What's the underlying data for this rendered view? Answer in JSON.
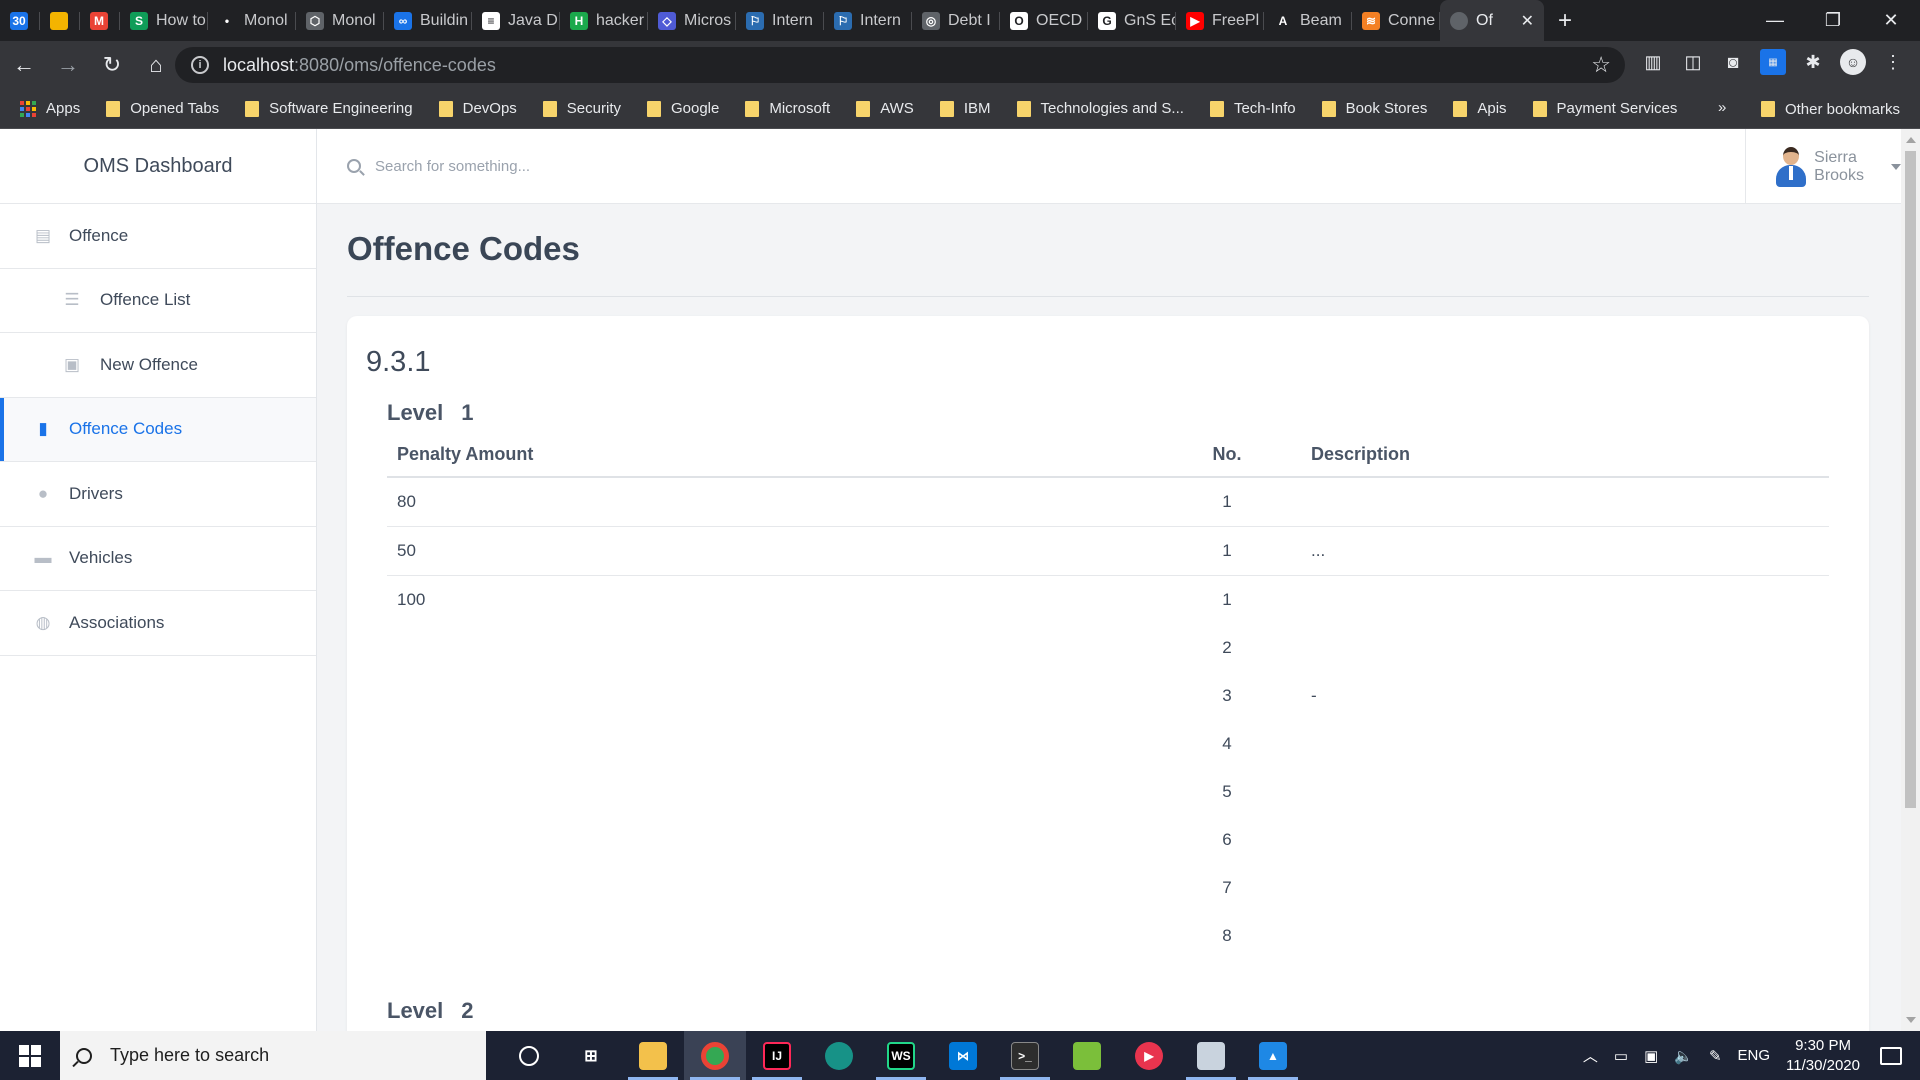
{
  "browser": {
    "tabs": [
      {
        "label": "",
        "color": "#1a73e8",
        "glyph": "30"
      },
      {
        "label": "",
        "color": "#f4b400",
        "glyph": ""
      },
      {
        "label": "",
        "color": "#ea4335",
        "glyph": "M"
      },
      {
        "label": "How to",
        "color": "#0f9d58",
        "glyph": "S"
      },
      {
        "label": "Monol",
        "color": "#202124",
        "glyph": "•"
      },
      {
        "label": "Monol",
        "color": "#5f6368",
        "glyph": "⬡"
      },
      {
        "label": "Buildin",
        "color": "#1a73e8",
        "glyph": "∞"
      },
      {
        "label": "Java D",
        "color": "#ffffff",
        "glyph": "≡"
      },
      {
        "label": "hacker",
        "color": "#1ba94c",
        "glyph": "H"
      },
      {
        "label": "Micros",
        "color": "#4f5bd5",
        "glyph": "◇"
      },
      {
        "label": "Intern",
        "color": "#2b6cb0",
        "glyph": "⚐"
      },
      {
        "label": "Intern",
        "color": "#2b6cb0",
        "glyph": "⚐"
      },
      {
        "label": "Debt I",
        "color": "#5f6368",
        "glyph": "◎"
      },
      {
        "label": "OECD",
        "color": "#ffffff",
        "glyph": "O"
      },
      {
        "label": "GnS Ec",
        "color": "#ffffff",
        "glyph": "G"
      },
      {
        "label": "FreePl",
        "color": "#ff0000",
        "glyph": "▶"
      },
      {
        "label": "Beam",
        "color": "#202124",
        "glyph": "A"
      },
      {
        "label": "Conne",
        "color": "#f48024",
        "glyph": "≋"
      }
    ],
    "active_tab": {
      "label": "Of",
      "close": "✕"
    },
    "new_tab": "+",
    "window": {
      "minimize": "—",
      "restore": "❐",
      "close": "✕"
    },
    "url_host": "localhost",
    "url_path": ":8080/oms/offence-codes",
    "bookmarks": [
      "Apps",
      "Opened Tabs",
      "Software Engineering",
      "DevOps",
      "Security",
      "Google",
      "Microsoft",
      "AWS",
      "IBM",
      "Technologies and S...",
      "Tech-Info",
      "Book Stores",
      "Apis",
      "Payment Services"
    ],
    "bookmarks_more": "»",
    "other_bookmarks": "Other bookmarks"
  },
  "app": {
    "brand": "OMS Dashboard",
    "nav": [
      {
        "label": "Offence",
        "icon": "document-icon",
        "sub": false,
        "active": false
      },
      {
        "label": "Offence List",
        "icon": "list-icon",
        "sub": true,
        "active": false
      },
      {
        "label": "New Offence",
        "icon": "new-document-icon",
        "sub": true,
        "active": false
      },
      {
        "label": "Offence Codes",
        "icon": "book-icon",
        "sub": false,
        "active": true
      },
      {
        "label": "Drivers",
        "icon": "person-icon",
        "sub": false,
        "active": false
      },
      {
        "label": "Vehicles",
        "icon": "car-icon",
        "sub": false,
        "active": false
      },
      {
        "label": "Associations",
        "icon": "group-icon",
        "sub": false,
        "active": false
      }
    ],
    "search_placeholder": "Search for something...",
    "user_name": "Sierra Brooks",
    "page_title": "Offence Codes",
    "code": "9.3.1",
    "levels": [
      {
        "label": "Level",
        "number": "1",
        "columns": [
          "Penalty Amount",
          "No.",
          "Description"
        ],
        "rows": [
          {
            "amount": "80",
            "nos": [
              "1"
            ],
            "descriptions": [
              ""
            ]
          },
          {
            "amount": "50",
            "nos": [
              "1"
            ],
            "descriptions": [
              "..."
            ]
          },
          {
            "amount": "100",
            "nos": [
              "1",
              "2",
              "3",
              "4",
              "5",
              "6",
              "7",
              "8"
            ],
            "descriptions": [
              "",
              "",
              "-",
              "",
              "",
              "",
              "",
              ""
            ]
          }
        ]
      },
      {
        "label": "Level",
        "number": "2"
      }
    ]
  },
  "taskbar": {
    "search_placeholder": "Type here to search",
    "language": "ENG",
    "time": "9:30 PM",
    "date": "11/30/2020"
  }
}
